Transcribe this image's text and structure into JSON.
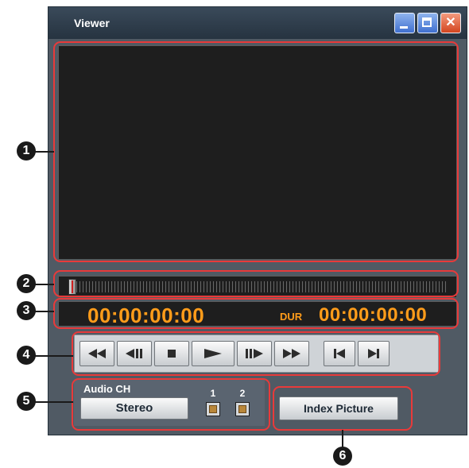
{
  "window": {
    "title": "Viewer",
    "controls": {
      "minimize": "minimize-icon",
      "maximize": "maximize-icon",
      "close": "close-icon",
      "close_glyph": "✕"
    }
  },
  "timecode": {
    "current": "00:00:00:00",
    "duration_label": "DUR",
    "duration": "00:00:00:00"
  },
  "transport": {
    "buttons": [
      "rewind-icon",
      "step-back-icon",
      "stop-icon",
      "play-icon",
      "step-forward-icon",
      "fast-forward-icon",
      "go-to-start-icon",
      "go-to-end-icon"
    ]
  },
  "audio": {
    "label": "Audio CH",
    "mode_button": "Stereo",
    "channels": [
      "1",
      "2"
    ]
  },
  "index_picture": {
    "label": "Index Picture"
  },
  "callouts": {
    "markers": [
      "1",
      "2",
      "3",
      "4",
      "5",
      "6"
    ]
  },
  "colors": {
    "timecode": "#ff9c1a",
    "callout_border": "#e83a3a",
    "panel": "#505a64",
    "screen": "#1e1e1e"
  }
}
